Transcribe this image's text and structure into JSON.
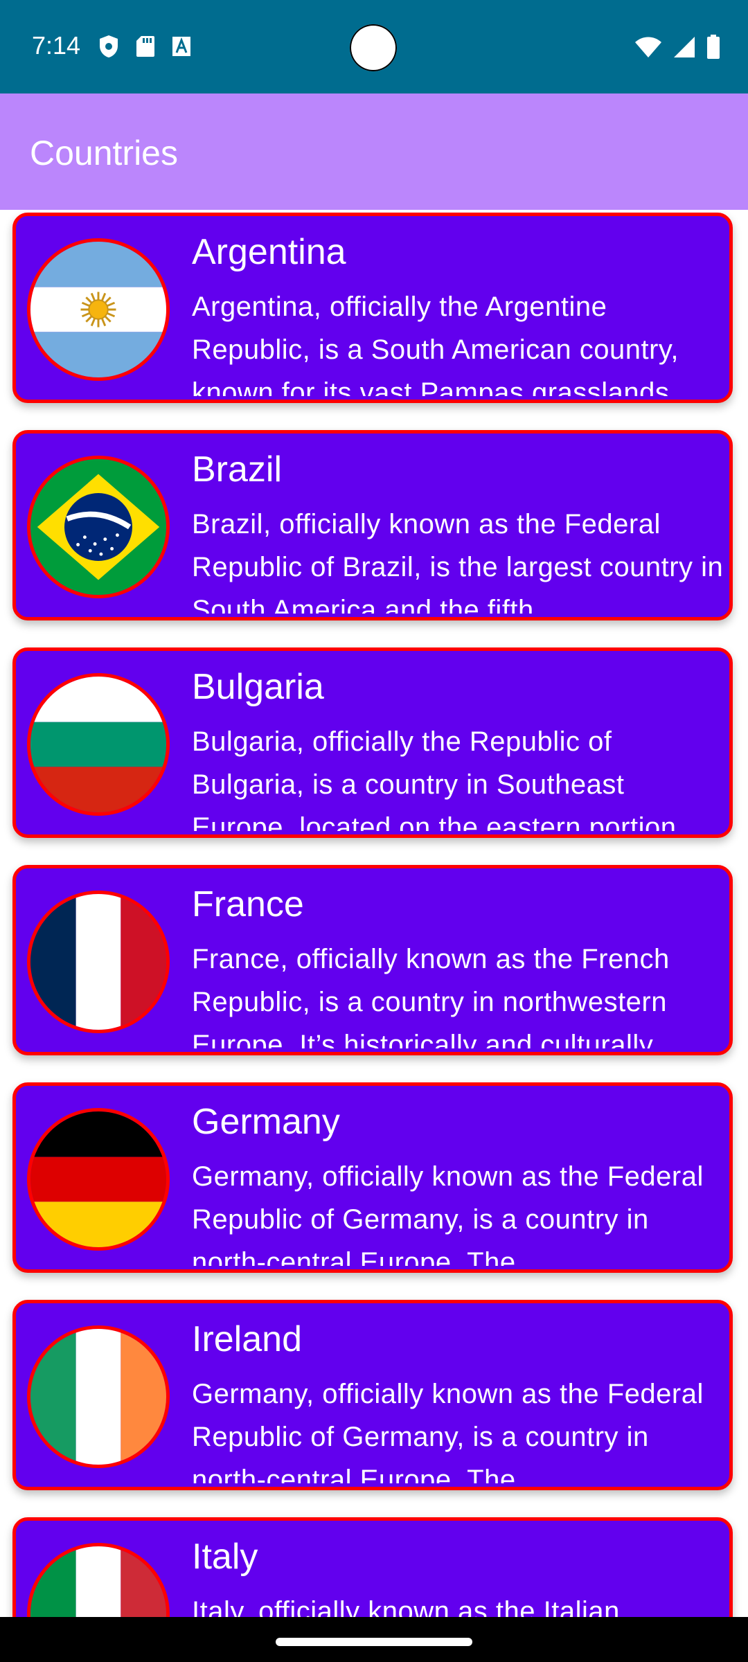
{
  "status_bar": {
    "time": "7:14",
    "left_icons": [
      "shield-icon",
      "sd-card-icon",
      "font-icon"
    ],
    "right_icons": [
      "wifi-icon",
      "signal-icon",
      "battery-icon"
    ]
  },
  "app_bar": {
    "title": "Countries",
    "color": "#bb86fc"
  },
  "colors": {
    "card_bg": "#6200ee",
    "card_border": "#ff0000",
    "status_bar": "#006c8f"
  },
  "countries": [
    {
      "name": "Argentina",
      "description": "Argentina, officially the Argentine Republic, is a South American country, known for its vast Pampas grasslands"
    },
    {
      "name": "Brazil",
      "description": "Brazil, officially known as the Federal Republic of Brazil, is the largest country in South America and the fifth"
    },
    {
      "name": "Bulgaria",
      "description": "Bulgaria, officially the Republic of Bulgaria, is a country in Southeast Europe, located on the eastern portion"
    },
    {
      "name": "France",
      "description": "France, officially known as the French Republic, is a country in northwestern Europe. It’s historically and culturally"
    },
    {
      "name": "Germany",
      "description": "Germany, officially known as the Federal Republic of Germany, is a country in north-central Europe. The"
    },
    {
      "name": "Ireland",
      "description": "Germany, officially known as the Federal Republic of Germany, is a country in north-central Europe. The"
    },
    {
      "name": "Italy",
      "description": "Italy, officially known as the Italian Republic"
    }
  ]
}
